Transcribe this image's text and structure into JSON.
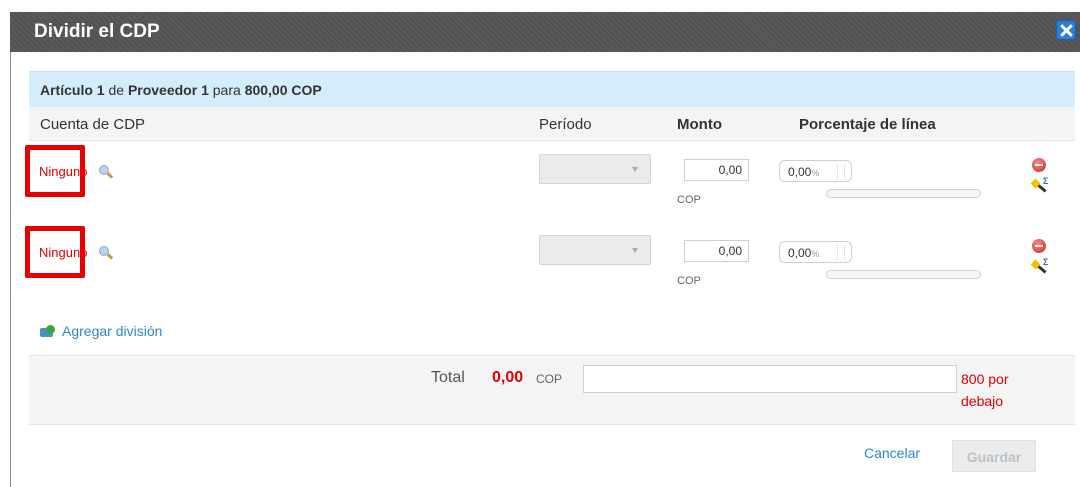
{
  "dialog": {
    "title": "Dividir el CDP",
    "close_icon": "close-icon"
  },
  "article": {
    "item_label": "Artículo 1",
    "from": "de",
    "supplier_label": "Proveedor 1",
    "for": "para",
    "amount": "800,00 COP"
  },
  "columns": {
    "account": "Cuenta de CDP",
    "period": "Período",
    "amount": "Monto",
    "percent": "Porcentaje de línea"
  },
  "rows": [
    {
      "account": "Ninguno",
      "period": "",
      "amount": "0,00",
      "currency": "COP",
      "percent": "0,00",
      "percent_unit": "%",
      "percent_level": 0
    },
    {
      "account": "Ninguno",
      "period": "",
      "amount": "0,00",
      "currency": "COP",
      "percent": "0,00",
      "percent_unit": "%",
      "percent_level": 0
    }
  ],
  "add_split_label": "Agregar división",
  "total": {
    "label": "Total",
    "value": "0,00",
    "currency": "COP",
    "status_line1": "800 por",
    "status_line2": "debajo"
  },
  "footer": {
    "cancel_label": "Cancelar",
    "save_label": "Guardar"
  },
  "colors": {
    "title_bar": "#555555",
    "article_bar": "#d4edfa",
    "error_red": "#e00000",
    "link_blue": "#2b89c9",
    "highlight_red": "#e80000"
  }
}
